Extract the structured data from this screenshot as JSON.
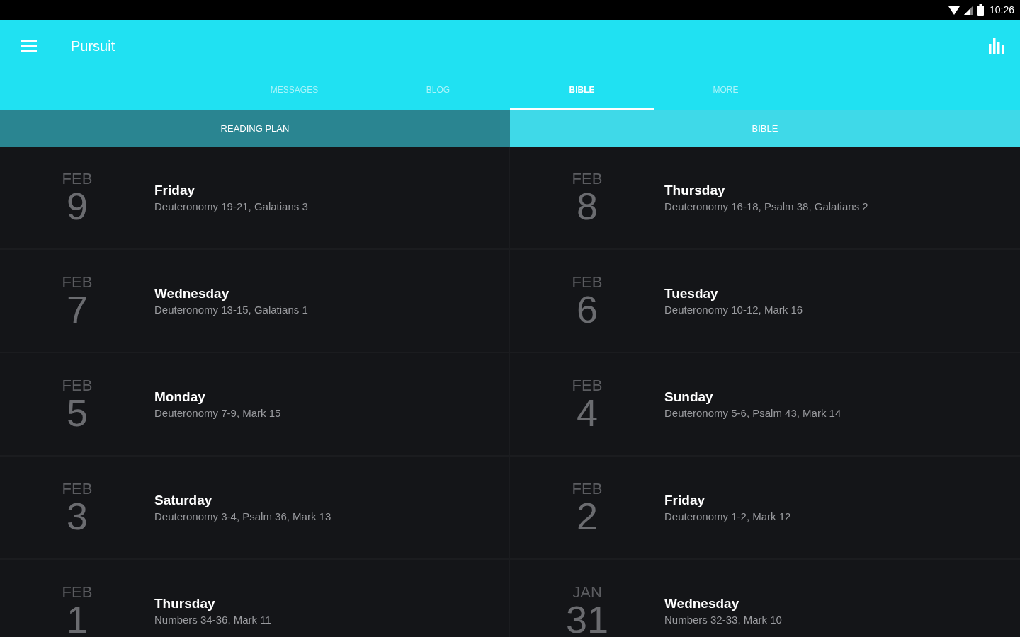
{
  "status_bar": {
    "time": "10:26"
  },
  "app_bar": {
    "title": "Pursuit"
  },
  "tabs": [
    {
      "label": "MESSAGES",
      "selected": false
    },
    {
      "label": "BLOG",
      "selected": false
    },
    {
      "label": "BIBLE",
      "selected": true
    },
    {
      "label": "MORE",
      "selected": false
    }
  ],
  "sub_tabs": [
    {
      "label": "READING PLAN",
      "selected": true
    },
    {
      "label": "BIBLE",
      "selected": false
    }
  ],
  "readings": [
    {
      "month": "FEB",
      "day": "9",
      "weekday": "Friday",
      "passages": "Deuteronomy 19-21, Galatians 3"
    },
    {
      "month": "FEB",
      "day": "8",
      "weekday": "Thursday",
      "passages": "Deuteronomy 16-18, Psalm 38, Galatians 2"
    },
    {
      "month": "FEB",
      "day": "7",
      "weekday": "Wednesday",
      "passages": "Deuteronomy 13-15, Galatians 1"
    },
    {
      "month": "FEB",
      "day": "6",
      "weekday": "Tuesday",
      "passages": "Deuteronomy 10-12, Mark 16"
    },
    {
      "month": "FEB",
      "day": "5",
      "weekday": "Monday",
      "passages": "Deuteronomy 7-9, Mark 15"
    },
    {
      "month": "FEB",
      "day": "4",
      "weekday": "Sunday",
      "passages": "Deuteronomy 5-6, Psalm 43, Mark 14"
    },
    {
      "month": "FEB",
      "day": "3",
      "weekday": "Saturday",
      "passages": "Deuteronomy 3-4, Psalm 36, Mark 13"
    },
    {
      "month": "FEB",
      "day": "2",
      "weekday": "Friday",
      "passages": "Deuteronomy 1-2, Mark 12"
    },
    {
      "month": "FEB",
      "day": "1",
      "weekday": "Thursday",
      "passages": "Numbers 34-36, Mark 11"
    },
    {
      "month": "JAN",
      "day": "31",
      "weekday": "Wednesday",
      "passages": "Numbers 32-33, Mark 10"
    }
  ]
}
